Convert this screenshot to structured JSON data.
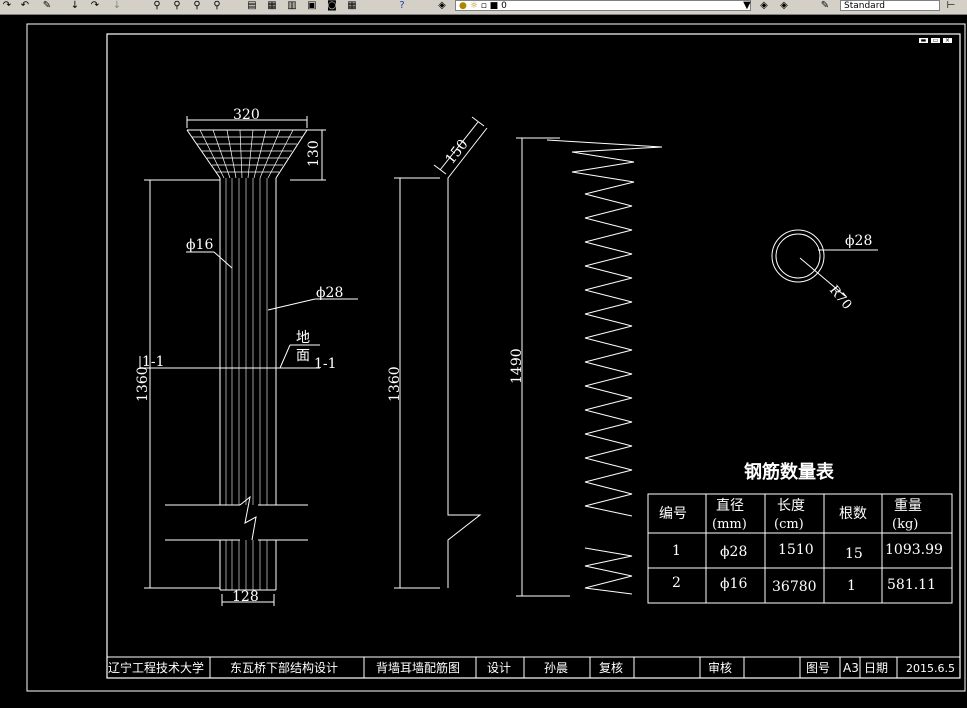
{
  "toolbar": {
    "layer_value": "0",
    "textstyle_value": "Standard"
  },
  "drawing": {
    "dim_top_width": "320",
    "dim_top_height": "130",
    "dim_main_height": "1360",
    "dim_bottom_width": "128",
    "label_phi16": "ϕ16",
    "label_phi28": "ϕ28",
    "label_ground_1": "地",
    "label_ground_2": "面",
    "label_section_left": "1-1",
    "label_section_right": "1-1",
    "dim_bent_150": "150",
    "dim_bent_1360": "1360",
    "dim_spiral_1490": "1490",
    "circle_label_phi28": "ϕ28",
    "circle_label_r70": "R70"
  },
  "rebar_table": {
    "title": "钢筋数量表",
    "headers": [
      {
        "l1": "编号",
        "l2": ""
      },
      {
        "l1": "直径",
        "l2": "(mm)"
      },
      {
        "l1": "长度",
        "l2": "(cm)"
      },
      {
        "l1": "根数",
        "l2": ""
      },
      {
        "l1": "重量",
        "l2": "(kg)"
      }
    ],
    "rows": [
      [
        "1",
        "ϕ28",
        "1510",
        "15",
        "1093.99"
      ],
      [
        "2",
        "ϕ16",
        "36780",
        "1",
        "581.11"
      ]
    ]
  },
  "title_block": {
    "school": "辽宁工程技术大学",
    "project": "东瓦桥下部结构设计",
    "drawing_name": "背墙耳墙配筋图",
    "design_label": "设计",
    "designer": "孙晨",
    "review_label": "复核",
    "reviewer": "",
    "audit_label": "审核",
    "auditor": "",
    "drawing_no_label": "图号",
    "sheet_size": "A3",
    "date_label": "日期",
    "date": "2015.6.5"
  }
}
